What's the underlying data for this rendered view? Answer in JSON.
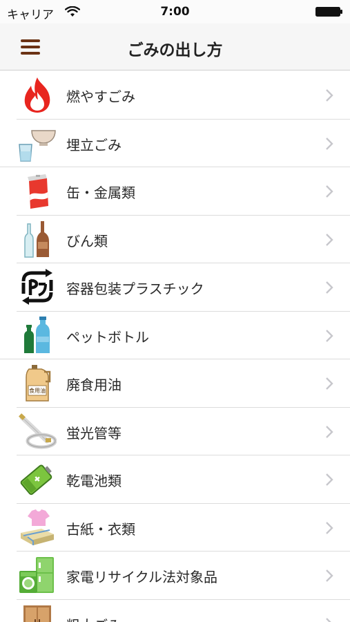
{
  "status_bar": {
    "carrier": "キャリア",
    "time": "7:00"
  },
  "nav": {
    "title": "ごみの出し方",
    "menu_icon": "hamburger-icon"
  },
  "items": [
    {
      "label": "燃やすごみ",
      "icon": "flame-icon"
    },
    {
      "label": "埋立ごみ",
      "icon": "ceramic-bowl-glass-icon"
    },
    {
      "label": "缶・金属類",
      "icon": "can-icon"
    },
    {
      "label": "びん類",
      "icon": "bottles-icon"
    },
    {
      "label": "容器包装プラスチック",
      "icon": "plastic-recycle-icon"
    },
    {
      "label": "ペットボトル",
      "icon": "pet-bottle-icon"
    },
    {
      "label": "廃食用油",
      "icon": "oil-jug-icon"
    },
    {
      "label": "蛍光管等",
      "icon": "fluorescent-tube-icon"
    },
    {
      "label": "乾電池類",
      "icon": "battery-icon"
    },
    {
      "label": "古紙・衣類",
      "icon": "paper-clothes-icon"
    },
    {
      "label": "家電リサイクル法対象品",
      "icon": "appliance-icon"
    },
    {
      "label": "粗大ごみ",
      "icon": "furniture-icon"
    }
  ],
  "oil_jug_label": "食用油"
}
